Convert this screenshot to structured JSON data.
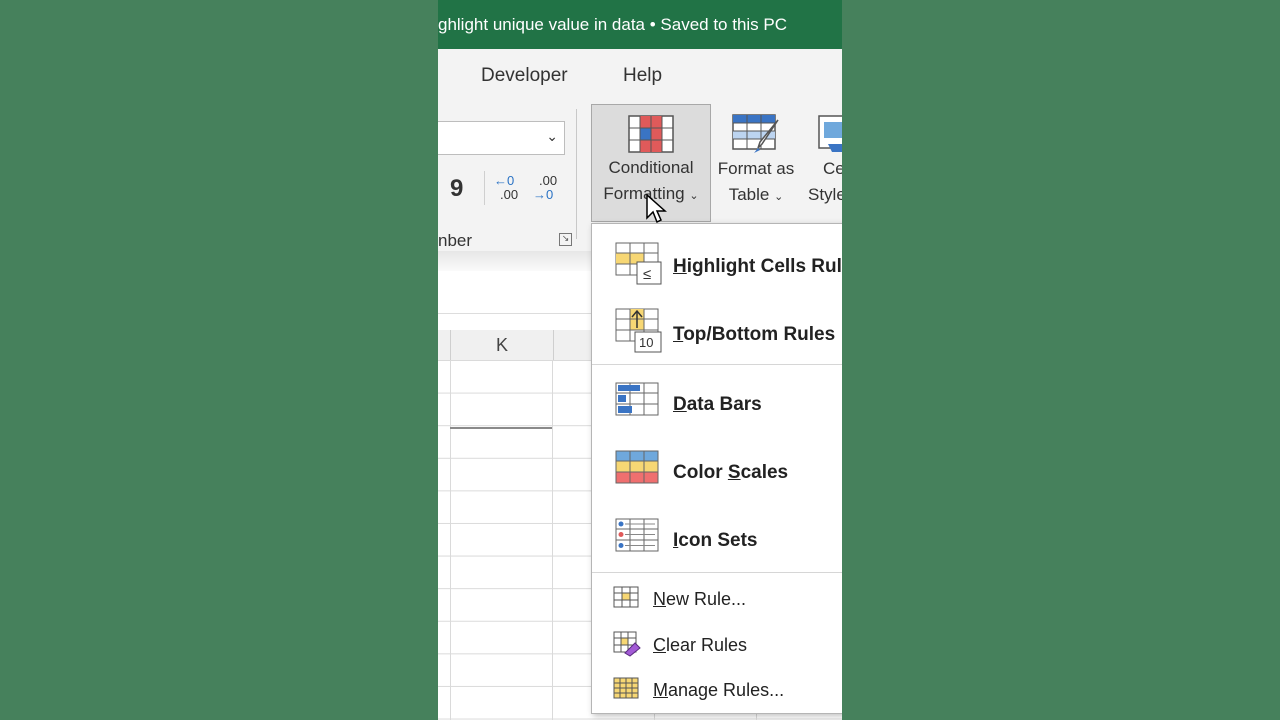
{
  "titlebar": {
    "title": "ghlight unique value in data  •  Saved to this PC"
  },
  "tabs": [
    {
      "label": "Developer"
    },
    {
      "label": "Help"
    }
  ],
  "ribbon": {
    "number_group_label": "nber",
    "comma_glyph": "9",
    "increase_decimal": "←0\n.00",
    "decrease_decimal": ".00\n→0",
    "buttons": {
      "conditional_formatting": {
        "line1": "Conditional",
        "line2": "Formatting"
      },
      "format_as_table": {
        "line1": "Format as",
        "line2": "Table"
      },
      "cell_styles": {
        "line1": "Ce",
        "line2": "Style"
      }
    }
  },
  "sheet": {
    "column_header": "K"
  },
  "menu": {
    "items": [
      {
        "label": "Highlight Cells Rule",
        "icon": "highlight-cells-rules-icon"
      },
      {
        "label": "Top/Bottom Rules",
        "icon": "top-bottom-rules-icon"
      },
      {
        "label": "Data Bars",
        "icon": "data-bars-icon"
      },
      {
        "label": "Color Scales",
        "icon": "color-scales-icon"
      },
      {
        "label": "Icon Sets",
        "icon": "icon-sets-icon"
      },
      {
        "label": "New Rule...",
        "icon": "new-rule-icon"
      },
      {
        "label": "Clear Rules",
        "icon": "clear-rules-icon"
      },
      {
        "label": "Manage Rules...",
        "icon": "manage-rules-icon"
      }
    ]
  },
  "colors": {
    "title_green": "#217346",
    "background_green": "#46815c",
    "ribbon_bg": "#f3f3f3"
  }
}
